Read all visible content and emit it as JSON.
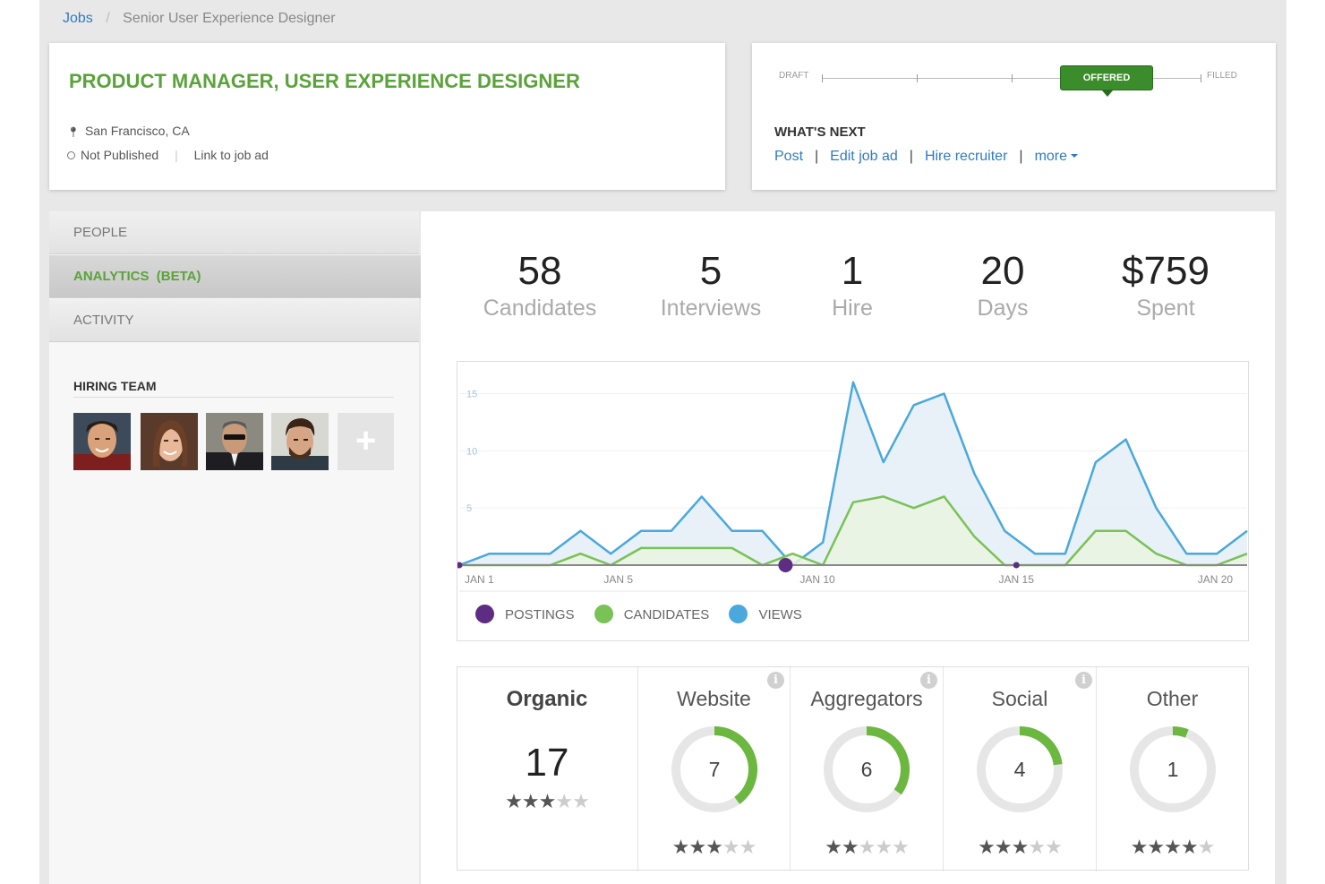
{
  "breadcrumb": {
    "root": "Jobs",
    "current": "Senior User Experience Designer"
  },
  "job": {
    "title": "PRODUCT MANAGER, USER EXPERIENCE DESIGNER",
    "location": "San Francisco, CA",
    "publish_status": "Not Published",
    "link_label": "Link to job ad"
  },
  "status": {
    "start_label": "DRAFT",
    "end_label": "FILLED",
    "current": "OFFERED",
    "next_title": "WHAT'S NEXT",
    "actions": [
      "Post",
      "Edit job ad",
      "Hire recruiter",
      "more"
    ]
  },
  "sidebar": {
    "nav": [
      "PEOPLE",
      "ANALYTICS  (BETA)",
      "ACTIVITY"
    ],
    "active_index": 1,
    "team_title": "HIRING TEAM",
    "add_symbol": "+"
  },
  "stats": [
    {
      "value": "58",
      "label": "Candidates"
    },
    {
      "value": "5",
      "label": "Interviews"
    },
    {
      "value": "1",
      "label": "Hire"
    },
    {
      "value": "20",
      "label": "Days"
    },
    {
      "value": "$759",
      "label": "Spent"
    }
  ],
  "chart_data": {
    "type": "area",
    "x": [
      1,
      2,
      3,
      4,
      5,
      6,
      7,
      8,
      9,
      10,
      11,
      12,
      13,
      14,
      15,
      16,
      17,
      18,
      19,
      20,
      21
    ],
    "x_tick_labels": {
      "1": "JAN 1",
      "5": "JAN 5",
      "10": "JAN 10",
      "15": "JAN 15",
      "20": "JAN 20"
    },
    "y_ticks": [
      5,
      10,
      15
    ],
    "ylim": [
      0,
      17
    ],
    "series": [
      {
        "name": "VIEWS",
        "color": "#4aa8dc",
        "fill": "#e3eef6",
        "values": [
          0,
          1,
          1,
          1,
          3,
          1,
          3,
          3,
          6,
          3,
          3,
          0,
          2,
          16,
          9,
          14,
          15,
          8,
          3,
          1,
          1,
          9,
          11,
          5,
          1,
          1,
          3
        ]
      },
      {
        "name": "CANDIDATES",
        "color": "#79c255",
        "fill": "#e9f5e1",
        "values": [
          0,
          0,
          0,
          0,
          1,
          0,
          1.5,
          1.5,
          1.5,
          1.5,
          0,
          1,
          0,
          5.5,
          6,
          5,
          6,
          2.5,
          0,
          0,
          0,
          3,
          3,
          1,
          0,
          0,
          1
        ]
      },
      {
        "name": "POSTINGS",
        "color": "#5c2d82",
        "points": [
          {
            "x": 1,
            "y": 0,
            "size": "small"
          },
          {
            "x": 9.2,
            "y": 0,
            "size": "large"
          },
          {
            "x": 15,
            "y": 0,
            "size": "small"
          }
        ]
      }
    ]
  },
  "legend": [
    {
      "label": "POSTINGS",
      "color": "#5c2d82"
    },
    {
      "label": "CANDIDATES",
      "color": "#79c255"
    },
    {
      "label": "VIEWS",
      "color": "#4aa8dc"
    }
  ],
  "sources": {
    "organic": {
      "name": "Organic",
      "value": "17",
      "rating": 3
    },
    "channels": [
      {
        "name": "Website",
        "value": "7",
        "fraction": 0.4,
        "rating": 3
      },
      {
        "name": "Aggregators",
        "value": "6",
        "fraction": 0.35,
        "rating": 2
      },
      {
        "name": "Social",
        "value": "4",
        "fraction": 0.23,
        "rating": 3
      },
      {
        "name": "Other",
        "value": "1",
        "fraction": 0.06,
        "rating": 4
      }
    ],
    "info_symbol": "i"
  }
}
